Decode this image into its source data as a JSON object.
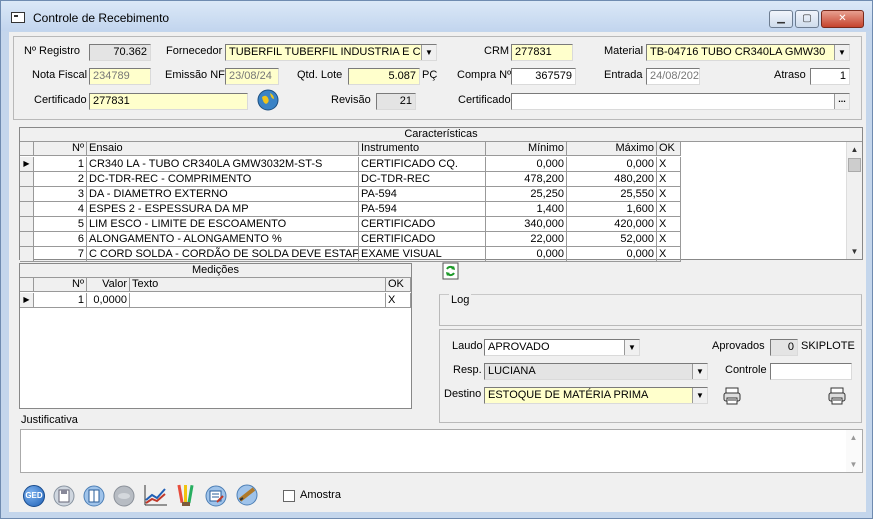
{
  "window": {
    "title": "Controle de Recebimento",
    "min": "▁",
    "max": "▢",
    "close": "✕"
  },
  "header": {
    "registro_label": "Nº Registro",
    "registro_value": "70.362",
    "fornecedor_label": "Fornecedor",
    "fornecedor_value": "TUBERFIL  TUBERFIL INDUSTRIA E C",
    "crm_label": "CRM",
    "crm_value": "277831",
    "material_label": "Material",
    "material_value": "TB-04716  TUBO  CR340LA  GMW30",
    "nota_fiscal_label": "Nota Fiscal",
    "nota_fiscal_value": "234789",
    "emissao_label": "Emissão NF",
    "emissao_value": "23/08/24",
    "qtd_lote_label": "Qtd. Lote",
    "qtd_lote_value": "5.087",
    "qtd_lote_unit": "PÇ",
    "compra_label": "Compra Nº",
    "compra_value": "367579",
    "entrada_label": "Entrada",
    "entrada_value": "24/08/202",
    "atraso_label": "Atraso",
    "atraso_value": "1",
    "certificado_label": "Certificado",
    "certificado_value": "277831",
    "revisao_label": "Revisão",
    "revisao_value": "21",
    "certificado2_label": "Certificado",
    "certificado2_value": "",
    "ellipsis": "..."
  },
  "caracteristicas": {
    "caption": "Características",
    "columns": {
      "n": "Nº",
      "ensaio": "Ensaio",
      "instrumento": "Instrumento",
      "minimo": "Mínimo",
      "maximo": "Máximo",
      "ok": "OK"
    },
    "rows": [
      {
        "n": "1",
        "ensaio": "CR340 LA  -  TUBO CR340LA GMW3032M-ST-S",
        "instrumento": "CERTIFICADO CQ.",
        "minimo": "0,000",
        "maximo": "0,000",
        "ok": "X"
      },
      {
        "n": "2",
        "ensaio": "DC-TDR-REC  -  COMPRIMENTO",
        "instrumento": "DC-TDR-REC",
        "minimo": "478,200",
        "maximo": "480,200",
        "ok": "X"
      },
      {
        "n": "3",
        "ensaio": "DA  -  DIAMETRO EXTERNO",
        "instrumento": "PA-594",
        "minimo": "25,250",
        "maximo": "25,550",
        "ok": "X"
      },
      {
        "n": "4",
        "ensaio": "ESPES 2  -  ESPESSURA DA MP",
        "instrumento": "PA-594",
        "minimo": "1,400",
        "maximo": "1,600",
        "ok": "X"
      },
      {
        "n": "5",
        "ensaio": "LIM ESCO  -  LIMITE DE ESCOAMENTO",
        "instrumento": "CERTIFICADO",
        "minimo": "340,000",
        "maximo": "420,000",
        "ok": "X"
      },
      {
        "n": "6",
        "ensaio": "ALONGAMENTO  -  ALONGAMENTO %",
        "instrumento": "CERTIFICADO",
        "minimo": "22,000",
        "maximo": "52,000",
        "ok": "X"
      },
      {
        "n": "7",
        "ensaio": "C CORD SOLDA  -  CORDÃO DE SOLDA DEVE ESTAF",
        "instrumento": "EXAME VISUAL",
        "minimo": "0,000",
        "maximo": "0,000",
        "ok": "X"
      }
    ]
  },
  "medicoes": {
    "caption": "Medições",
    "columns": {
      "n": "Nº",
      "valor": "Valor",
      "texto": "Texto",
      "ok": "OK"
    },
    "rows": [
      {
        "n": "1",
        "valor": "0,0000",
        "texto": "",
        "ok": "X"
      }
    ]
  },
  "log": {
    "label": "Log"
  },
  "laudo": {
    "laudo_label": "Laudo",
    "laudo_value": "APROVADO",
    "aprovados_label": "Aprovados",
    "aprovados_value": "0",
    "skiplote": "SKIPLOTE",
    "resp_label": "Resp.",
    "resp_value": "LUCIANA",
    "controle_label": "Controle",
    "controle_value": "",
    "destino_label": "Destino",
    "destino_value": "ESTOQUE DE MATÉRIA PRIMA"
  },
  "justificativa": {
    "label": "Justificativa",
    "value": ""
  },
  "toolbar": {
    "ged_label": "GED",
    "amostra_label": "Amostra"
  },
  "glyphs": {
    "arrow_down": "▼",
    "arrow_up": "▲",
    "row_pointer": "▶"
  },
  "colors": {
    "yellow_field": "#ffffcc",
    "gray_field": "#e4e4e4",
    "window_frame": "#c4d6ec"
  }
}
